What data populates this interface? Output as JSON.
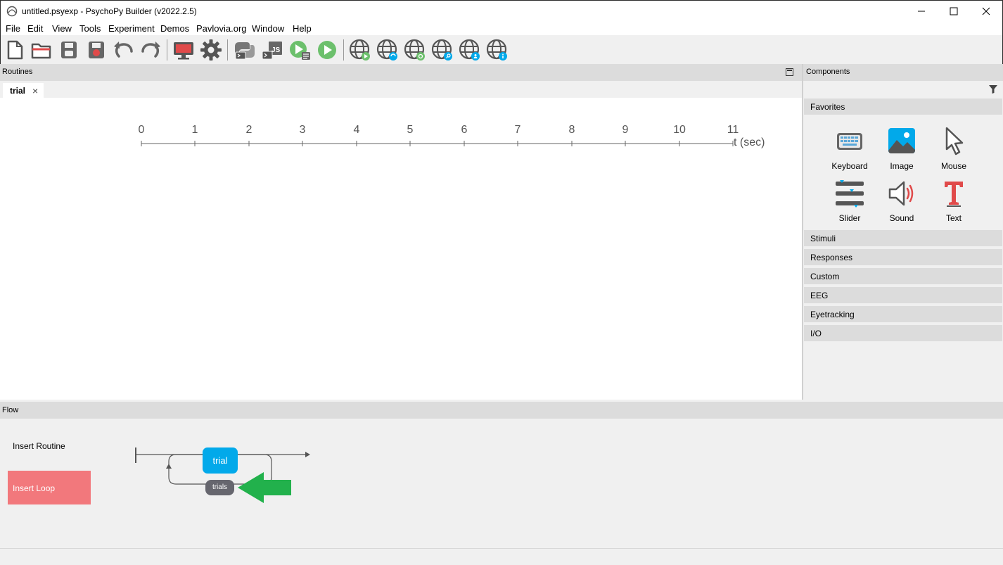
{
  "window": {
    "title": "untitled.psyexp - PsychoPy Builder (v2022.2.5)"
  },
  "menu": [
    {
      "label": "File"
    },
    {
      "label": "Edit"
    },
    {
      "label": "View"
    },
    {
      "label": "Tools"
    },
    {
      "label": "Experiment"
    },
    {
      "label": "Demos"
    },
    {
      "label": "Pavlovia.org"
    },
    {
      "label": "Window"
    },
    {
      "label": "Help"
    }
  ],
  "toolbar": {
    "icons": [
      "new-file-icon",
      "open-folder-icon",
      "save-icon",
      "save-as-icon",
      "undo-icon",
      "redo-icon",
      "monitor-center-icon",
      "experiment-settings-icon",
      "compile-python-icon",
      "compile-js-icon",
      "runner-icon",
      "run-icon",
      "pavlovia-run-icon",
      "pavlovia-sync-icon",
      "pavlovia-refresh-icon",
      "pavlovia-search-icon",
      "pavlovia-user-icon",
      "pavlovia-info-icon"
    ]
  },
  "routines": {
    "header": "Routines",
    "tabs": [
      {
        "label": "trial",
        "close": "×"
      }
    ],
    "timeline": {
      "ticks": [
        "0",
        "1",
        "2",
        "3",
        "4",
        "5",
        "6",
        "7",
        "8",
        "9",
        "10",
        "11"
      ],
      "unit": "t (sec)"
    }
  },
  "components": {
    "header": "Components",
    "favorites_label": "Favorites",
    "favorites": [
      {
        "label": "Keyboard",
        "icon": "keyboard-icon"
      },
      {
        "label": "Image",
        "icon": "image-icon"
      },
      {
        "label": "Mouse",
        "icon": "mouse-cursor-icon"
      },
      {
        "label": "Slider",
        "icon": "slider-icon"
      },
      {
        "label": "Sound",
        "icon": "sound-icon"
      },
      {
        "label": "Text",
        "icon": "text-icon"
      }
    ],
    "categories": [
      {
        "label": "Stimuli"
      },
      {
        "label": "Responses"
      },
      {
        "label": "Custom"
      },
      {
        "label": "EEG"
      },
      {
        "label": "Eyetracking"
      },
      {
        "label": "I/O"
      }
    ]
  },
  "flow": {
    "header": "Flow",
    "insert_routine": "Insert Routine",
    "insert_loop": "Insert Loop",
    "routine_label": "trial",
    "loop_label": "trials"
  },
  "colors": {
    "routine_blue": "#02a9ea",
    "loop_gray": "#66666e",
    "insert_loop_pink": "#f2787c",
    "annotation_arrow_green": "#22b14c"
  }
}
